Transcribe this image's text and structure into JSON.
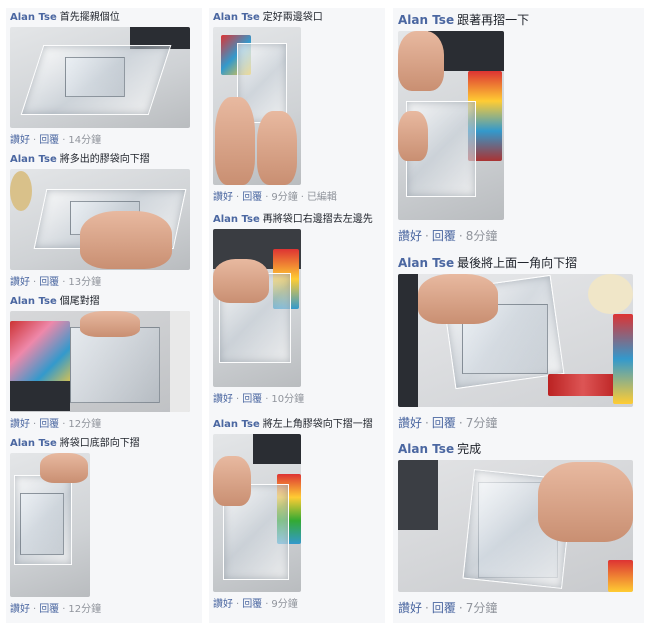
{
  "actions": {
    "like": "讚好",
    "reply": "回覆",
    "edited": "已編輯"
  },
  "columns": [
    [
      {
        "author": "Alan Tse",
        "text": "首先擺親個位",
        "time": "14分鐘"
      },
      {
        "author": "Alan Tse",
        "text": "將多出的膠袋向下摺",
        "time": "13分鐘"
      },
      {
        "author": "Alan Tse",
        "text": "個尾對摺",
        "time": "12分鐘"
      },
      {
        "author": "Alan Tse",
        "text": "將袋口底部向下摺",
        "time": "12分鐘"
      }
    ],
    [
      {
        "author": "Alan Tse",
        "text": "定好兩邊袋口",
        "time": "9分鐘"
      },
      {
        "author": "Alan Tse",
        "text": "再將袋口右邊摺去左邊先",
        "time": "10分鐘"
      },
      {
        "author": "Alan Tse",
        "text": "將左上角膠袋向下摺一摺",
        "time": "9分鐘"
      }
    ],
    [
      {
        "author": "Alan Tse",
        "text": "跟著再摺一下",
        "time": "8分鐘"
      },
      {
        "author": "Alan Tse",
        "text": "最後將上面一角向下摺",
        "time": "7分鐘"
      },
      {
        "author": "Alan Tse",
        "text": "完成",
        "time": "7分鐘"
      }
    ]
  ]
}
